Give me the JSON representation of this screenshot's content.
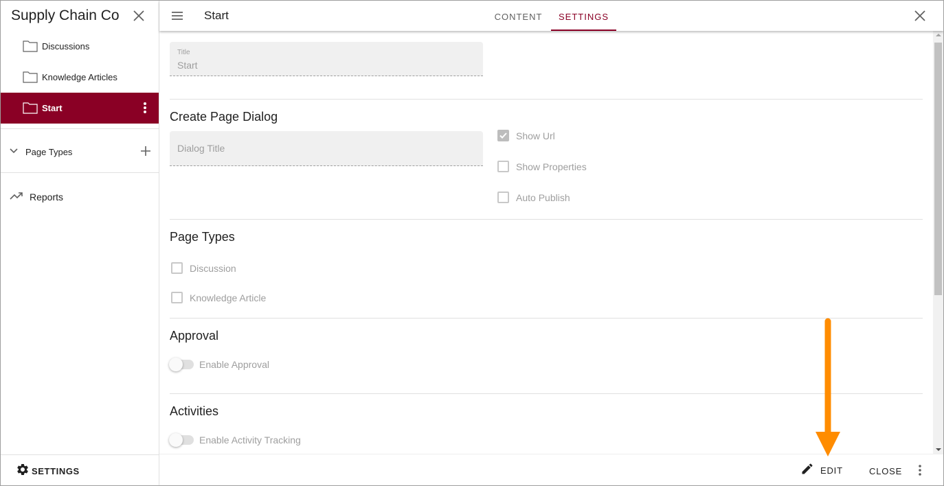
{
  "sidebar": {
    "title": "Supply Chain Co",
    "items": [
      {
        "label": "Discussions",
        "icon": "folder-icon",
        "active": false
      },
      {
        "label": "Knowledge Articles",
        "icon": "folder-icon",
        "active": false
      },
      {
        "label": "Start",
        "icon": "folder-icon",
        "active": true
      }
    ],
    "page_types_label": "Page Types",
    "reports_label": "Reports",
    "settings_label": "SETTINGS"
  },
  "header": {
    "page_title": "Start",
    "tabs": [
      {
        "label": "CONTENT",
        "active": false
      },
      {
        "label": "SETTINGS",
        "active": true
      }
    ]
  },
  "form": {
    "title_field": {
      "label": "Title",
      "value": "Start"
    },
    "create_page_dialog": {
      "heading": "Create Page Dialog",
      "dialog_title_placeholder": "Dialog Title",
      "show_url": {
        "label": "Show Url",
        "checked": true
      },
      "show_properties": {
        "label": "Show Properties",
        "checked": false
      },
      "auto_publish": {
        "label": "Auto Publish",
        "checked": false
      }
    },
    "page_types": {
      "heading": "Page Types",
      "options": [
        {
          "label": "Discussion",
          "checked": false
        },
        {
          "label": "Knowledge Article",
          "checked": false
        }
      ]
    },
    "approval": {
      "heading": "Approval",
      "toggle_label": "Enable Approval",
      "enabled": false
    },
    "activities": {
      "heading": "Activities",
      "toggle_label": "Enable Activity Tracking",
      "enabled": false
    }
  },
  "footer": {
    "edit_label": "EDIT",
    "close_label": "CLOSE"
  },
  "colors": {
    "accent": "#8a0025",
    "annotation_arrow": "#ff8c00"
  }
}
